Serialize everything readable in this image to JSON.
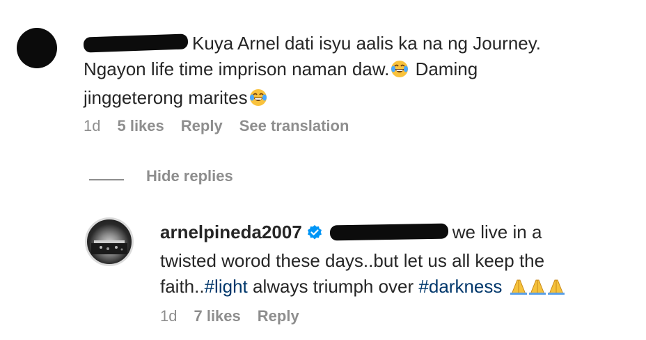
{
  "comment": {
    "text_line1": "Kuya Arnel dati isyu aalis ka na ng Journey.",
    "text_line2": "Ngayon life time imprison naman daw.",
    "text_line2b": "Daming",
    "text_line3": "jinggeterong marites",
    "age": "1d",
    "likes": "5 likes",
    "reply_label": "Reply",
    "translate_label": "See translation"
  },
  "replies_toggle": {
    "label": "Hide replies"
  },
  "reply": {
    "username": "arnelpineda2007",
    "text_part1": "we live in a",
    "text_part2": "twisted worod these days..but let us all keep the",
    "text_part3": "faith..",
    "hashtag1": "#light",
    "text_part4": "always triumph over",
    "hashtag2": "#darkness",
    "age": "1d",
    "likes": "7 likes",
    "reply_label": "Reply"
  },
  "icons": {
    "laugh": "face-with-tears-of-joy-icon",
    "pray": "folded-hands-icon",
    "verified": "verified-badge-icon"
  },
  "colors": {
    "text": "#262626",
    "muted": "#8e8e8e",
    "hashtag": "#00376b",
    "verified": "#0095f6"
  }
}
